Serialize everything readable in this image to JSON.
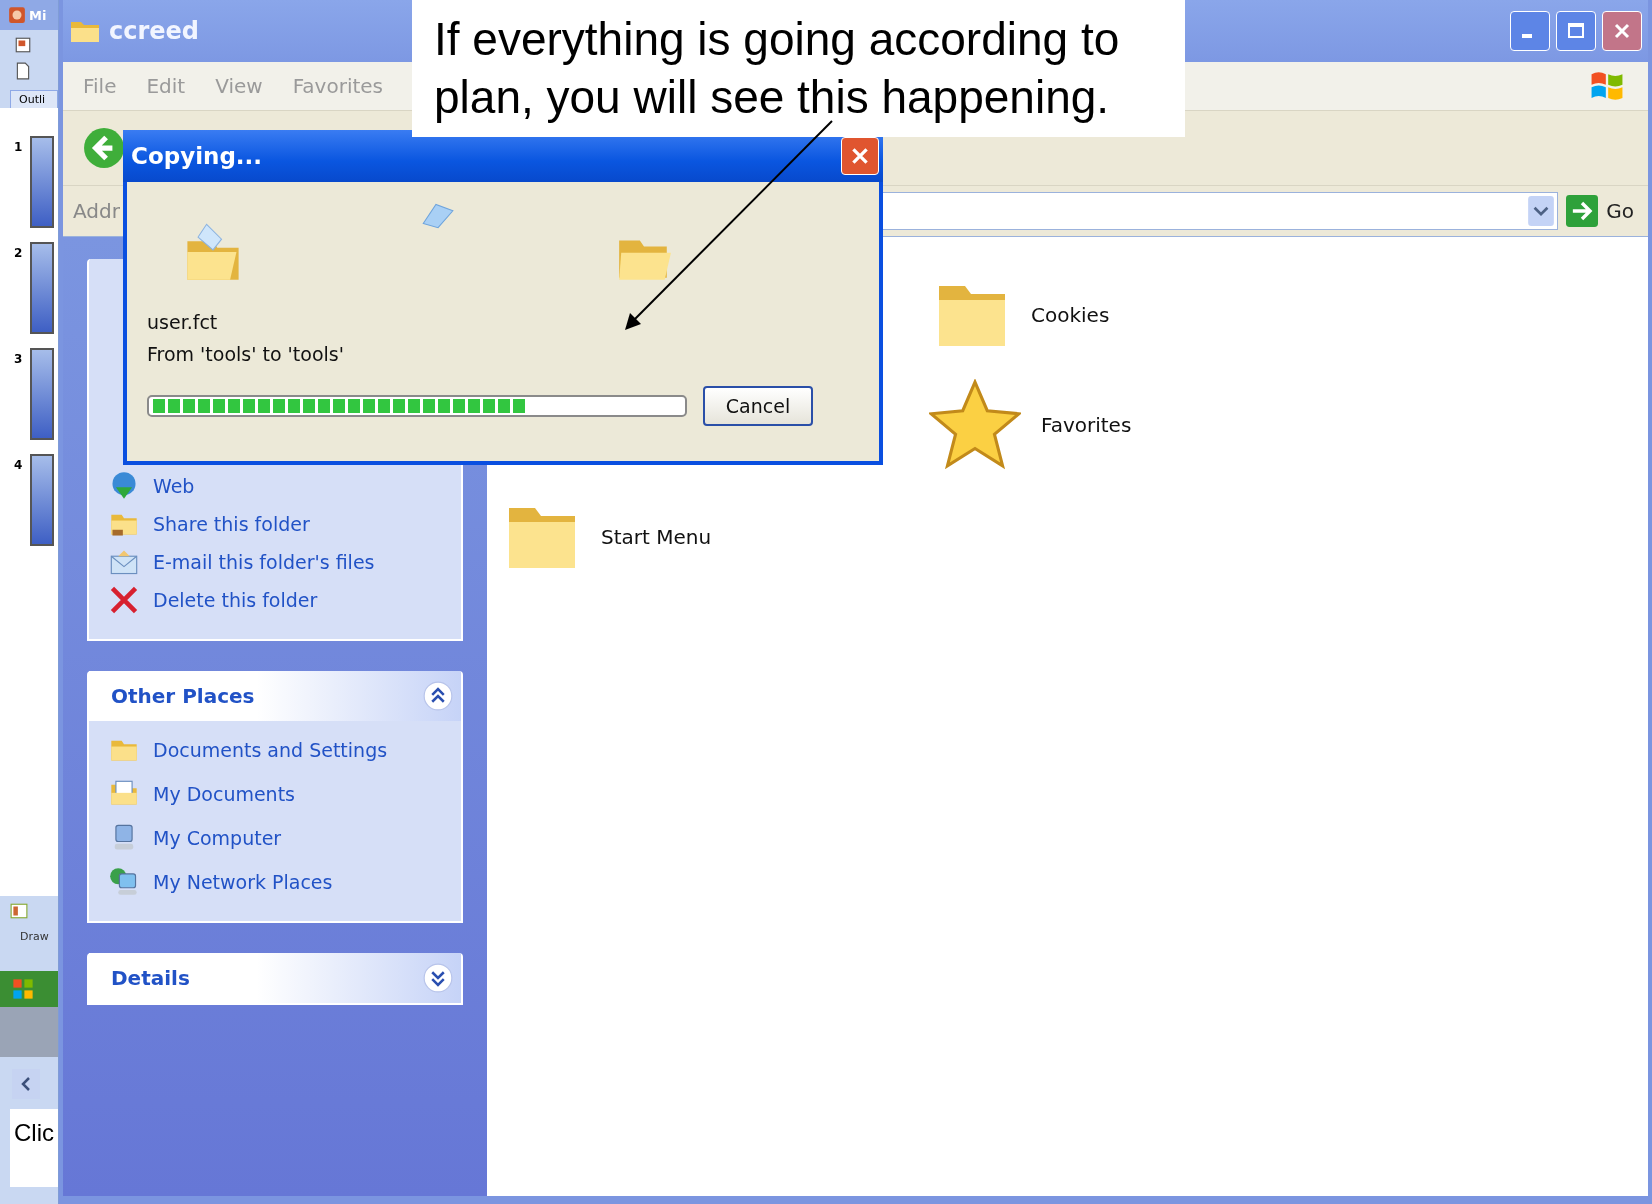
{
  "background_app": {
    "title": "Mi",
    "tab": "Outli",
    "slides": [
      "1",
      "2",
      "3",
      "4"
    ],
    "drawing_toolbar": "Draw",
    "notes": "Clic"
  },
  "window": {
    "title": "ccreed",
    "menu": [
      "File",
      "Edit",
      "View",
      "Favorites"
    ],
    "address_label": "Addr",
    "go_button": "Go"
  },
  "tasks_panel": {
    "items": [
      {
        "label": "Web",
        "kind": "publish"
      },
      {
        "label": "Share this folder",
        "kind": "share"
      },
      {
        "label": "E-mail this folder's files",
        "kind": "email"
      },
      {
        "label": "Delete this folder",
        "kind": "delete"
      }
    ]
  },
  "other_places": {
    "title": "Other Places",
    "expanded": true,
    "items": [
      {
        "label": "Documents and Settings",
        "kind": "folder"
      },
      {
        "label": "My Documents",
        "kind": "documents"
      },
      {
        "label": "My Computer",
        "kind": "computer"
      },
      {
        "label": "My Network Places",
        "kind": "network"
      }
    ]
  },
  "details": {
    "title": "Details",
    "expanded": false
  },
  "files": [
    {
      "name": "Cookies",
      "kind": "folder"
    },
    {
      "name": "Favorites",
      "kind": "favorites"
    },
    {
      "name": "Start Menu",
      "kind": "folder"
    }
  ],
  "dialog": {
    "title": "Copying...",
    "file_name": "user.fct",
    "transfer": "From 'tools' to 'tools'",
    "progress": {
      "level": 0.71
    },
    "cancel_button": "Cancel"
  },
  "callout": {
    "text": "If everything is going according to plan, you will see this happening."
  }
}
